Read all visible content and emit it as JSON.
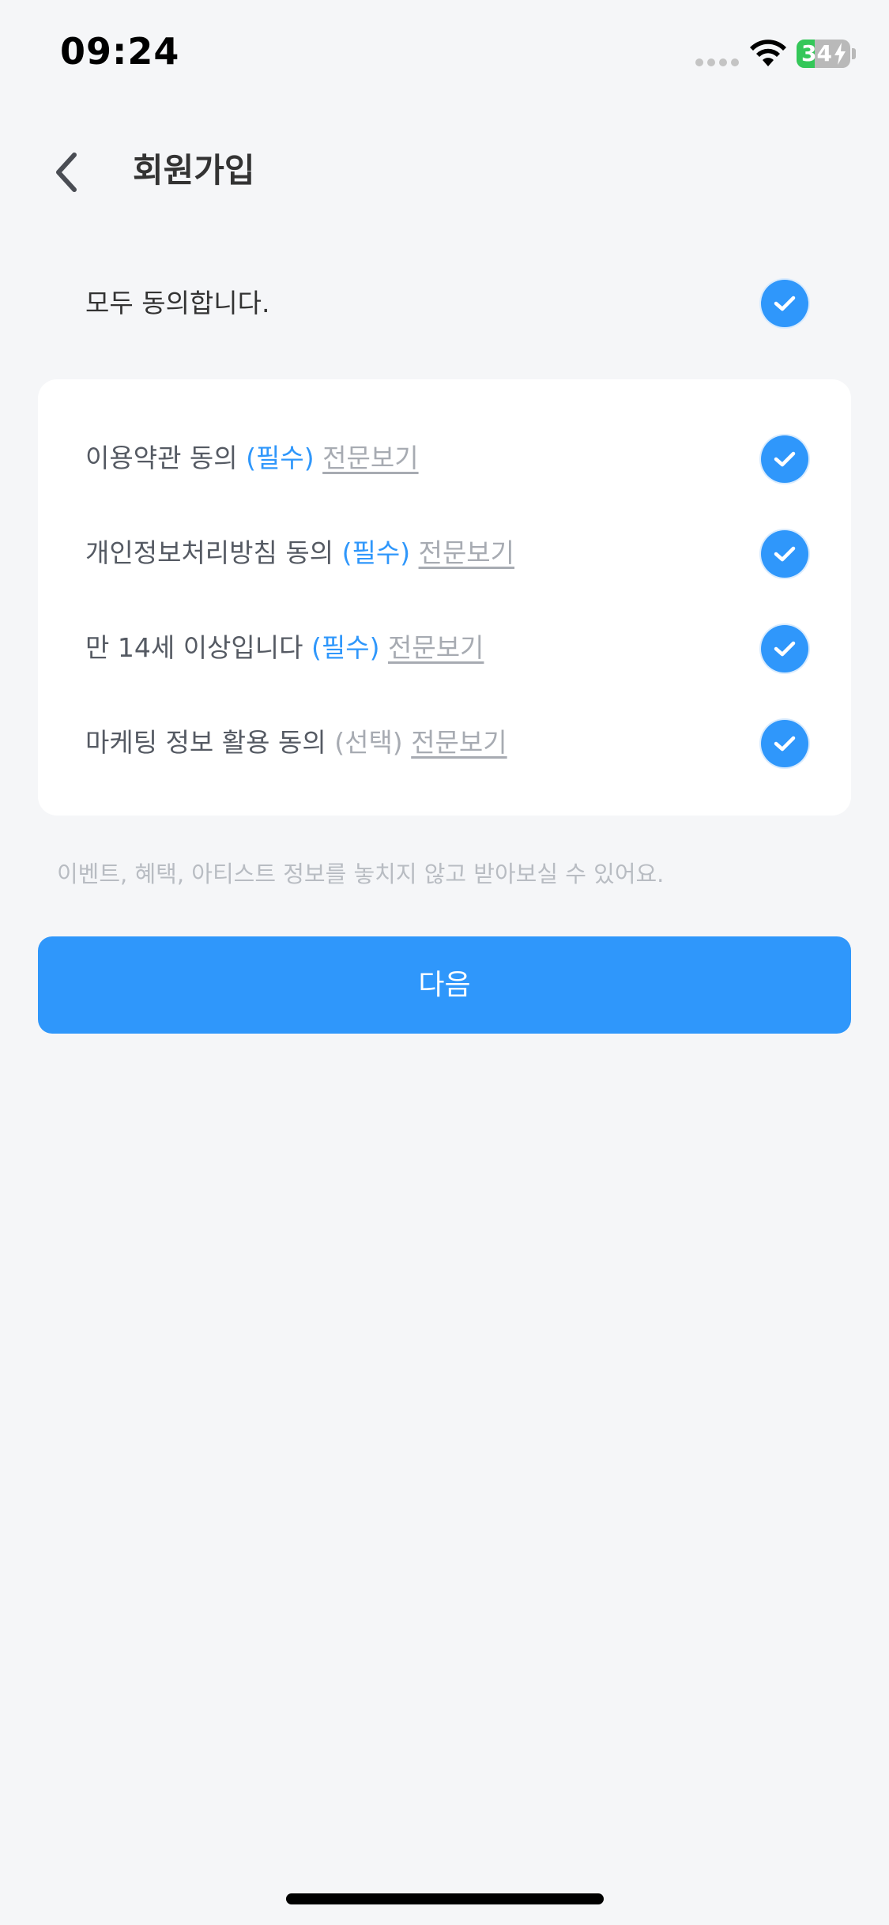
{
  "status_bar": {
    "time": "09:24",
    "battery_level": "34",
    "battery_fraction": 0.34,
    "battery_color": "#34c759"
  },
  "header": {
    "back_icon": "chevron-left-icon",
    "title": "회원가입"
  },
  "agree_all": {
    "label": "모두 동의합니다.",
    "checked": true
  },
  "terms": [
    {
      "label": "이용약관 동의 ",
      "tag": "(필수)",
      "required": true,
      "view": "전문보기",
      "checked": true
    },
    {
      "label": "개인정보처리방침 동의 ",
      "tag": "(필수)",
      "required": true,
      "view": "전문보기",
      "checked": true
    },
    {
      "label": "만 14세 이상입니다 ",
      "tag": "(필수)",
      "required": true,
      "view": "전문보기",
      "checked": true
    },
    {
      "label": "마케팅 정보 활용 동의 ",
      "tag": "(선택)",
      "required": false,
      "view": "전문보기",
      "checked": true
    }
  ],
  "marketing_note": "이벤트, 혜택, 아티스트 정보를 놓치지 않고 받아보실 수 있어요.",
  "next_button": "다음",
  "colors": {
    "accent": "#2f97fb",
    "background": "#f5f6f8",
    "card": "#ffffff"
  }
}
